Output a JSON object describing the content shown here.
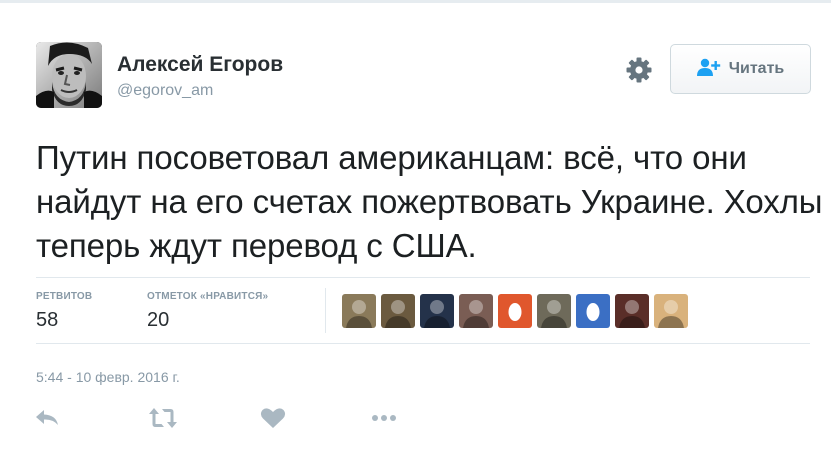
{
  "tweet": {
    "author_name": "Алексей Егоров",
    "author_handle": "@egorov_am",
    "text": "Путин посоветовал американцам: всё, что они найдут на его счетах пожертвовать Украине. Хохлы теперь ждут перевод с США.",
    "timestamp": "5:44 - 10 февр. 2016 г."
  },
  "header": {
    "settings_icon": "gear-icon",
    "follow_label": "Читать",
    "follow_icon": "person-plus-icon"
  },
  "stats": {
    "retweets_label": "РЕТВИТОВ",
    "retweets_value": "58",
    "likes_label": "ОТМЕТОК «НРАВИТСЯ»",
    "likes_value": "20",
    "likers": [
      {
        "icon": "user-avatar",
        "color": "#8a7a5a"
      },
      {
        "icon": "user-avatar",
        "color": "#6b5a3f"
      },
      {
        "icon": "user-avatar",
        "color": "#24324a"
      },
      {
        "icon": "user-avatar",
        "color": "#7a5d54"
      },
      {
        "icon": "egg-avatar",
        "color": "#e0572d"
      },
      {
        "icon": "user-avatar",
        "color": "#6e6a5a"
      },
      {
        "icon": "egg-avatar",
        "color": "#3b6fc4"
      },
      {
        "icon": "user-avatar",
        "color": "#5a2e28"
      },
      {
        "icon": "user-avatar",
        "color": "#d9b27c"
      }
    ]
  },
  "actions": [
    {
      "name": "reply-icon"
    },
    {
      "name": "retweet-icon"
    },
    {
      "name": "like-icon"
    },
    {
      "name": "more-icon"
    }
  ],
  "colors": {
    "text": "#1c2022",
    "muted": "#8899a6",
    "divider": "#e1e8ed",
    "icon": "#aab8c2",
    "follow_icon": "#1da1f2"
  }
}
